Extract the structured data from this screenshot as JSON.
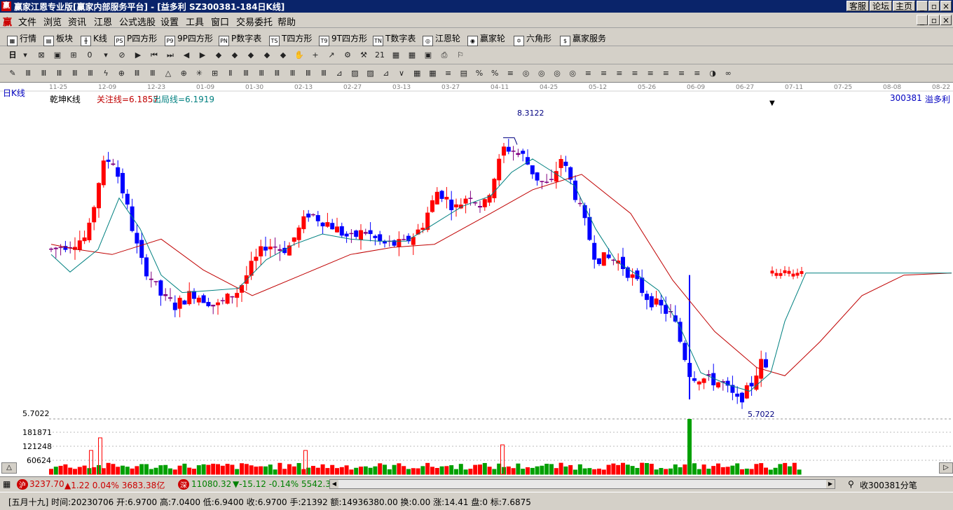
{
  "window": {
    "icon_glyph": "赢",
    "title": "赢家江恩专业版[赢家内部服务平台] - [益多利   SZ300381-184日K线]",
    "buttons": [
      "客服",
      "论坛",
      "主页"
    ],
    "win_controls": [
      "_",
      "▫",
      "×"
    ]
  },
  "menu": {
    "logo": "赢",
    "items": [
      "文件",
      "浏览",
      "资讯",
      "江恩",
      "公式选股",
      "设置",
      "工具",
      "窗口",
      "交易委托",
      "帮助"
    ]
  },
  "toolbar1": {
    "items": [
      {
        "icon": "▦",
        "label": "行情"
      },
      {
        "icon": "▤",
        "label": "板块"
      },
      {
        "icon": "╫",
        "label": "K线"
      },
      {
        "icon": "PS",
        "label": "P四方形"
      },
      {
        "icon": "P9",
        "label": "9P四方形"
      },
      {
        "icon": "PN",
        "label": "P数字表"
      },
      {
        "icon": "TS",
        "label": "T四方形"
      },
      {
        "icon": "T9",
        "label": "9T四方形"
      },
      {
        "icon": "TN",
        "label": "T数字表"
      },
      {
        "icon": "◎",
        "label": "江恩轮"
      },
      {
        "icon": "◉",
        "label": "赢家轮"
      },
      {
        "icon": "✡",
        "label": "六角形"
      },
      {
        "icon": "$",
        "label": "赢家服务"
      }
    ]
  },
  "toolbar2": {
    "period": "日",
    "icons": [
      "▾",
      "⊠",
      "▣",
      "⊞",
      "0",
      "▾",
      "⊘",
      "▶",
      "⏮",
      "⏭",
      "◀",
      "▶",
      "◆",
      "◆",
      "◆",
      "◆",
      "◆",
      "✋",
      "+",
      "↗",
      "⚙",
      "⚒",
      "21",
      "▦",
      "▦",
      "▣",
      "⎙",
      "⚐"
    ]
  },
  "toolbar3": {
    "icons": [
      "✎",
      "Ⅲ",
      "Ⅲ",
      "Ⅲ",
      "Ⅲ",
      "Ⅲ",
      "ϟ",
      "⊕",
      "Ⅲ",
      "Ⅲ",
      "△",
      "⊕",
      "✳",
      "⊞",
      "Ⅱ",
      "Ⅲ",
      "Ⅲ",
      "Ⅲ",
      "Ⅲ",
      "Ⅲ",
      "Ⅲ",
      "⊿",
      "▨",
      "▨",
      "⊿",
      "∨",
      "▦",
      "▦",
      "≡",
      "▤",
      "%",
      "%",
      "≡",
      "◎",
      "◎",
      "◎",
      "◎",
      "≡",
      "≡",
      "≡",
      "≡",
      "≡",
      "≡",
      "≡",
      "≡",
      "◑",
      "∞"
    ]
  },
  "chart": {
    "period_label": "日K线",
    "indicator_name": "乾坤K线",
    "focus_line_label": "关注线=6.1857",
    "exit_line_label": "出局线=6.1919",
    "stock_code": "300381",
    "stock_name": "溢多利",
    "date_ticks": [
      "11-25",
      "12-09",
      "12-23",
      "01-09",
      "01-30",
      "02-13",
      "02-27",
      "03-13",
      "03-27",
      "04-11",
      "04-25",
      "05-12",
      "05-26",
      "06-09",
      "06-27",
      "07-11",
      "07-25",
      "08-08",
      "08-22"
    ],
    "high_label": "8.3122",
    "low_label": "5.7022",
    "low_axis_label": "5.7022",
    "volume_ticks": [
      "181871",
      "121248",
      "60624"
    ],
    "colors": {
      "up": "#ff0000",
      "down": "#0000ff",
      "neutral": "#800080",
      "focus": "#c00000",
      "exit": "#008080",
      "volume": "#00a000",
      "volume_up": "#ff0000"
    }
  },
  "chart_data": {
    "type": "candlestick",
    "ylim": [
      5.55,
      8.55
    ],
    "focus_line": 6.1857,
    "exit_line": 6.1919,
    "high": 8.3122,
    "low": 5.7022,
    "volume_ticks": [
      181871,
      121248,
      60624
    ]
  },
  "status": {
    "sh_badge": "沪",
    "sh_index": "3237.70",
    "sh_change": "▲1.22 0.04% 3683.38亿",
    "sz_badge": "深",
    "sz_index": "11080.32",
    "sz_change": "▼-15.12 -0.14% 5542.3",
    "right_label": "收300381分笔"
  },
  "info": {
    "text": "[五月十九] 时间:20230706 开:6.9700 高:7.0400 低:6.9400 收:6.9700 手:21392 额:14936380.00 换:0.00 涨:14.41 盘:0 标:7.6875"
  }
}
